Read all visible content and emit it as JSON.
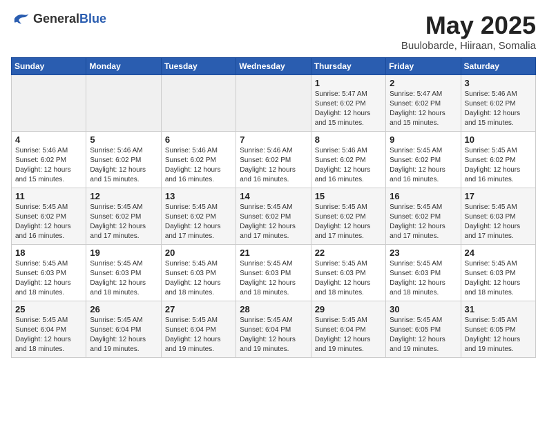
{
  "logo": {
    "general": "General",
    "blue": "Blue"
  },
  "title": "May 2025",
  "location": "Buulobarde, Hiiraan, Somalia",
  "days_of_week": [
    "Sunday",
    "Monday",
    "Tuesday",
    "Wednesday",
    "Thursday",
    "Friday",
    "Saturday"
  ],
  "weeks": [
    [
      {
        "day": "",
        "info": ""
      },
      {
        "day": "",
        "info": ""
      },
      {
        "day": "",
        "info": ""
      },
      {
        "day": "",
        "info": ""
      },
      {
        "day": "1",
        "info": "Sunrise: 5:47 AM\nSunset: 6:02 PM\nDaylight: 12 hours\nand 15 minutes."
      },
      {
        "day": "2",
        "info": "Sunrise: 5:47 AM\nSunset: 6:02 PM\nDaylight: 12 hours\nand 15 minutes."
      },
      {
        "day": "3",
        "info": "Sunrise: 5:46 AM\nSunset: 6:02 PM\nDaylight: 12 hours\nand 15 minutes."
      }
    ],
    [
      {
        "day": "4",
        "info": "Sunrise: 5:46 AM\nSunset: 6:02 PM\nDaylight: 12 hours\nand 15 minutes."
      },
      {
        "day": "5",
        "info": "Sunrise: 5:46 AM\nSunset: 6:02 PM\nDaylight: 12 hours\nand 15 minutes."
      },
      {
        "day": "6",
        "info": "Sunrise: 5:46 AM\nSunset: 6:02 PM\nDaylight: 12 hours\nand 16 minutes."
      },
      {
        "day": "7",
        "info": "Sunrise: 5:46 AM\nSunset: 6:02 PM\nDaylight: 12 hours\nand 16 minutes."
      },
      {
        "day": "8",
        "info": "Sunrise: 5:46 AM\nSunset: 6:02 PM\nDaylight: 12 hours\nand 16 minutes."
      },
      {
        "day": "9",
        "info": "Sunrise: 5:45 AM\nSunset: 6:02 PM\nDaylight: 12 hours\nand 16 minutes."
      },
      {
        "day": "10",
        "info": "Sunrise: 5:45 AM\nSunset: 6:02 PM\nDaylight: 12 hours\nand 16 minutes."
      }
    ],
    [
      {
        "day": "11",
        "info": "Sunrise: 5:45 AM\nSunset: 6:02 PM\nDaylight: 12 hours\nand 16 minutes."
      },
      {
        "day": "12",
        "info": "Sunrise: 5:45 AM\nSunset: 6:02 PM\nDaylight: 12 hours\nand 17 minutes."
      },
      {
        "day": "13",
        "info": "Sunrise: 5:45 AM\nSunset: 6:02 PM\nDaylight: 12 hours\nand 17 minutes."
      },
      {
        "day": "14",
        "info": "Sunrise: 5:45 AM\nSunset: 6:02 PM\nDaylight: 12 hours\nand 17 minutes."
      },
      {
        "day": "15",
        "info": "Sunrise: 5:45 AM\nSunset: 6:02 PM\nDaylight: 12 hours\nand 17 minutes."
      },
      {
        "day": "16",
        "info": "Sunrise: 5:45 AM\nSunset: 6:02 PM\nDaylight: 12 hours\nand 17 minutes."
      },
      {
        "day": "17",
        "info": "Sunrise: 5:45 AM\nSunset: 6:03 PM\nDaylight: 12 hours\nand 17 minutes."
      }
    ],
    [
      {
        "day": "18",
        "info": "Sunrise: 5:45 AM\nSunset: 6:03 PM\nDaylight: 12 hours\nand 18 minutes."
      },
      {
        "day": "19",
        "info": "Sunrise: 5:45 AM\nSunset: 6:03 PM\nDaylight: 12 hours\nand 18 minutes."
      },
      {
        "day": "20",
        "info": "Sunrise: 5:45 AM\nSunset: 6:03 PM\nDaylight: 12 hours\nand 18 minutes."
      },
      {
        "day": "21",
        "info": "Sunrise: 5:45 AM\nSunset: 6:03 PM\nDaylight: 12 hours\nand 18 minutes."
      },
      {
        "day": "22",
        "info": "Sunrise: 5:45 AM\nSunset: 6:03 PM\nDaylight: 12 hours\nand 18 minutes."
      },
      {
        "day": "23",
        "info": "Sunrise: 5:45 AM\nSunset: 6:03 PM\nDaylight: 12 hours\nand 18 minutes."
      },
      {
        "day": "24",
        "info": "Sunrise: 5:45 AM\nSunset: 6:03 PM\nDaylight: 12 hours\nand 18 minutes."
      }
    ],
    [
      {
        "day": "25",
        "info": "Sunrise: 5:45 AM\nSunset: 6:04 PM\nDaylight: 12 hours\nand 18 minutes."
      },
      {
        "day": "26",
        "info": "Sunrise: 5:45 AM\nSunset: 6:04 PM\nDaylight: 12 hours\nand 19 minutes."
      },
      {
        "day": "27",
        "info": "Sunrise: 5:45 AM\nSunset: 6:04 PM\nDaylight: 12 hours\nand 19 minutes."
      },
      {
        "day": "28",
        "info": "Sunrise: 5:45 AM\nSunset: 6:04 PM\nDaylight: 12 hours\nand 19 minutes."
      },
      {
        "day": "29",
        "info": "Sunrise: 5:45 AM\nSunset: 6:04 PM\nDaylight: 12 hours\nand 19 minutes."
      },
      {
        "day": "30",
        "info": "Sunrise: 5:45 AM\nSunset: 6:05 PM\nDaylight: 12 hours\nand 19 minutes."
      },
      {
        "day": "31",
        "info": "Sunrise: 5:45 AM\nSunset: 6:05 PM\nDaylight: 12 hours\nand 19 minutes."
      }
    ]
  ]
}
